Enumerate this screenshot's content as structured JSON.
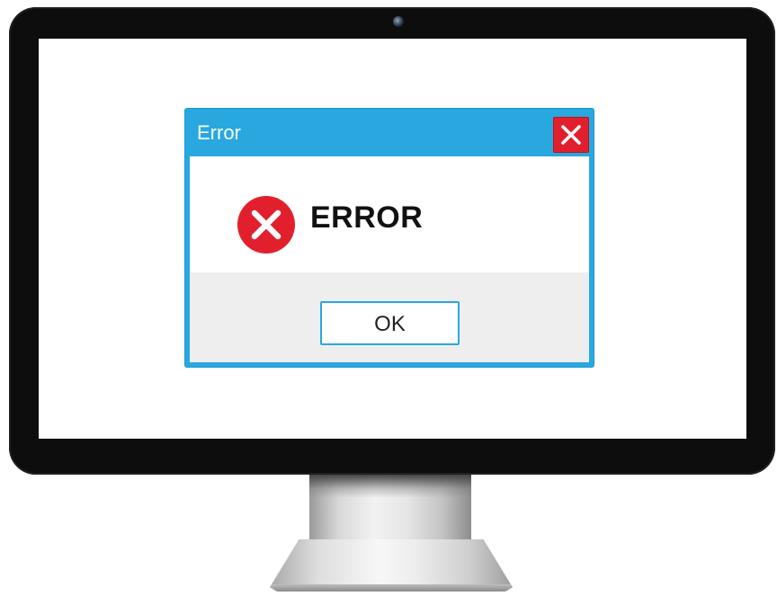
{
  "dialog": {
    "title": "Error",
    "message": "ERROR",
    "ok_label": "OK",
    "close_icon": "close-icon",
    "message_icon": "error-icon"
  },
  "colors": {
    "titlebar": "#29a8e0",
    "close_button": "#e2202d",
    "error_icon": "#e2202d",
    "footer": "#eeeeee",
    "bezel": "#0d0d0d"
  }
}
